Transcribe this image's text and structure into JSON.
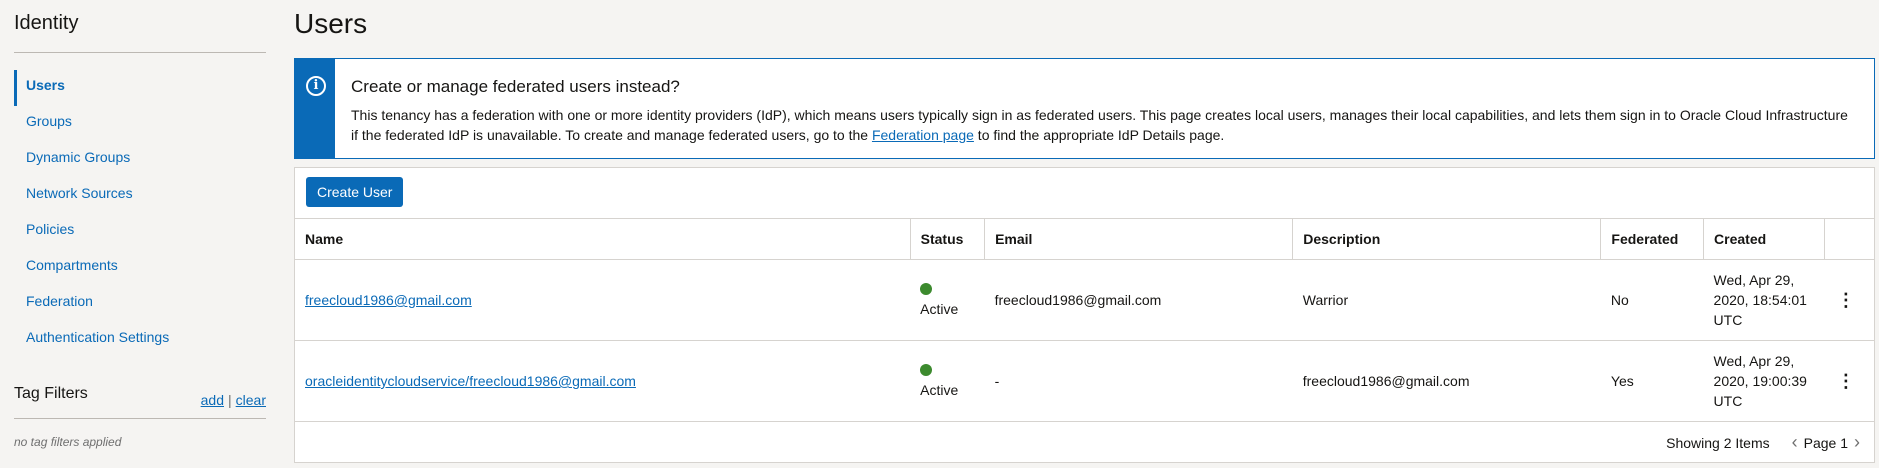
{
  "sidebar": {
    "title": "Identity",
    "items": [
      {
        "label": "Users"
      },
      {
        "label": "Groups"
      },
      {
        "label": "Dynamic Groups"
      },
      {
        "label": "Network Sources"
      },
      {
        "label": "Policies"
      },
      {
        "label": "Compartments"
      },
      {
        "label": "Federation"
      },
      {
        "label": "Authentication Settings"
      }
    ],
    "active_item": "Users",
    "tag_filters": {
      "title": "Tag Filters",
      "add_label": "add",
      "separator": "|",
      "clear_label": "clear",
      "empty_text": "no tag filters applied"
    }
  },
  "main": {
    "title": "Users",
    "banner": {
      "icon": "info-icon",
      "title": "Create or manage federated users instead?",
      "text_before_link": "This tenancy has a federation with one or more identity providers (IdP), which means users typically sign in as federated users. This page creates local users, manages their local capabilities, and lets them sign in to Oracle Cloud Infrastructure if the federated IdP is unavailable. To create and manage federated users, go to the ",
      "link_text": "Federation page",
      "text_after_link": " to find the appropriate IdP Details page."
    },
    "create_button": "Create User",
    "table": {
      "columns": [
        "Name",
        "Status",
        "Email",
        "Description",
        "Federated",
        "Created"
      ],
      "rows": [
        {
          "name": "freecloud1986@gmail.com",
          "status": "Active",
          "email": "freecloud1986@gmail.com",
          "description": "Warrior",
          "federated": "No",
          "created_line1": "Wed, Apr 29,",
          "created_line2": "2020, 18:54:01",
          "created_line3": "UTC",
          "menu_icon": "kebab-menu-icon"
        },
        {
          "name": "oracleidentitycloudservice/freecloud1986@gmail.com",
          "status": "Active",
          "email": "-",
          "description": "freecloud1986@gmail.com",
          "federated": "Yes",
          "created_line1": "Wed, Apr 29,",
          "created_line2": "2020, 19:00:39",
          "created_line3": "UTC",
          "menu_icon": "kebab-menu-icon"
        }
      ]
    },
    "footer": {
      "showing_text": "Showing 2 Items",
      "page_text": "Page 1"
    },
    "colors": {
      "accent": "#0a6ab7",
      "status_active": "#3c8a2e"
    }
  }
}
